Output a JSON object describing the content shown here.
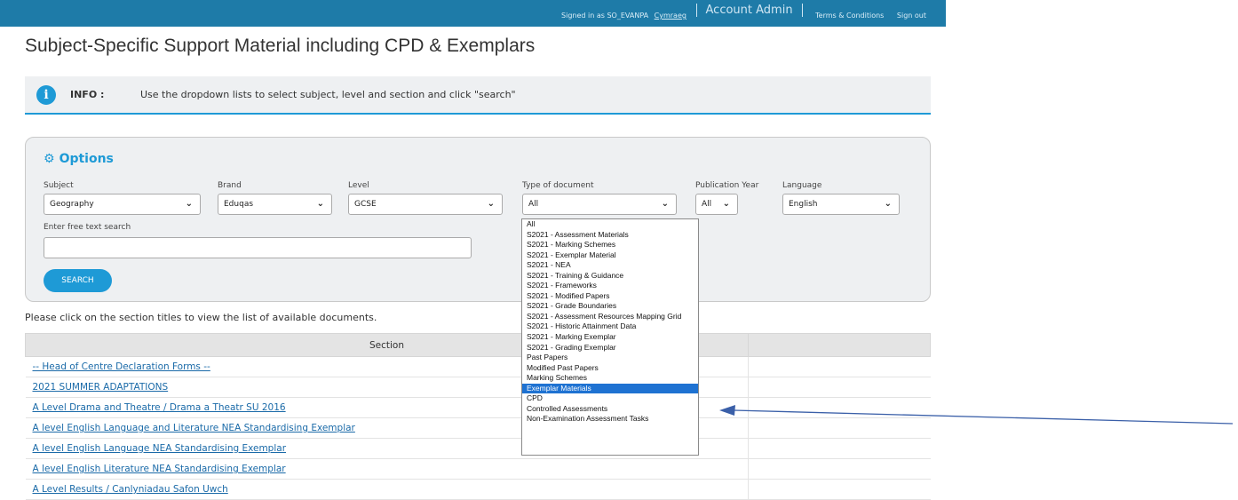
{
  "topbar": {
    "signed_in": "Signed in as SO_EVANPA",
    "cymraeg": "Cymraeg",
    "account_admin": "Account Admin",
    "terms": "Terms & Conditions",
    "sign_out": "Sign out",
    "color": "#1e7ba8"
  },
  "page_title": "Subject-Specific Support Material including CPD & Exemplars",
  "info": {
    "icon": "info-icon",
    "label": "INFO :",
    "message": "Use the dropdown lists to select subject, level and section and click \"search\""
  },
  "options": {
    "title": "Options",
    "gear_icon": "gear-icon",
    "fields": {
      "subject": {
        "label": "Subject",
        "value": "Geography"
      },
      "brand": {
        "label": "Brand",
        "value": "Eduqas"
      },
      "level": {
        "label": "Level",
        "value": "GCSE"
      },
      "doc_type": {
        "label": "Type of document",
        "value": "All"
      },
      "pub_year": {
        "label": "Publication Year",
        "value": "All"
      },
      "language": {
        "label": "Language",
        "value": "English"
      }
    },
    "free_text_label": "Enter free text search",
    "free_text_value": "",
    "search_button": "SEARCH"
  },
  "instruction": "Please click on the section titles to view the list of available documents.",
  "table": {
    "header": "Section",
    "rows": [
      "-- Head of Centre Declaration Forms --",
      "2021 SUMMER ADAPTATIONS",
      "A Level Drama and Theatre / Drama a Theatr SU 2016",
      "A level English Language and Literature NEA Standardising Exemplar",
      "A level English Language NEA Standardising Exemplar",
      "A level English Literature NEA Standardising Exemplar",
      "A Level Results / Canlyniadau Safon Uwch"
    ]
  },
  "dropdown": {
    "highlighted_index": 19,
    "highlight_color": "#1e72d2",
    "options": [
      "All",
      "S2021 - Assessment Materials",
      "S2021 - Marking Schemes",
      "S2021 - Exemplar Material",
      "S2021 - NEA",
      "S2021 - Training & Guidance",
      "S2021 - Frameworks",
      "S2021 - Modified Papers",
      "S2021 - Grade Boundaries",
      "S2021 - Assessment Resources Mapping Grid",
      "S2021 - Historic Attainment Data",
      "S2021 - Marking Exemplar",
      "S2021 - Grading Exemplar",
      "Past Papers",
      "Modified Past Papers",
      "Marking Schemes",
      "Exemplar Materials",
      "CPD",
      "Controlled Assessments",
      "Non-Examination Assessment Tasks"
    ]
  }
}
